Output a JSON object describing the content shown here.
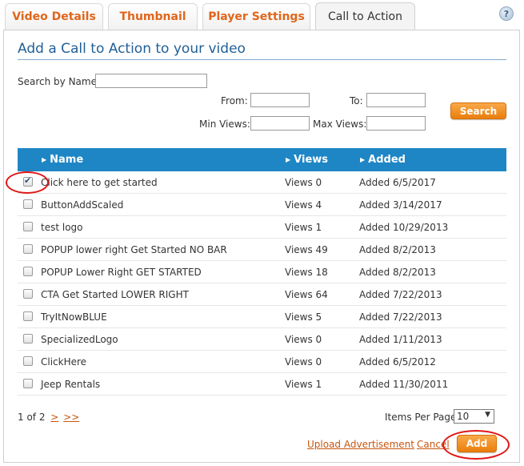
{
  "tabs": [
    {
      "label": "Video Details",
      "active": false
    },
    {
      "label": "Thumbnail",
      "active": false
    },
    {
      "label": "Player Settings",
      "active": false
    },
    {
      "label": "Call to Action",
      "active": true
    }
  ],
  "help_label": "?",
  "panel_title": "Add a Call to Action to your video",
  "search": {
    "name_label": "Search by Name:",
    "from_label": "From:",
    "to_label": "To:",
    "min_views_label": "Min Views:",
    "max_views_label": "Max Views:",
    "name_value": "",
    "from_value": "",
    "to_value": "",
    "min_value": "",
    "max_value": "",
    "button_label": "Search"
  },
  "table": {
    "headers": [
      "Name",
      "Views",
      "Added"
    ],
    "rows": [
      {
        "name": "Click here to get started",
        "views": "Views 0",
        "added": "Added 6/5/2017",
        "checked": true
      },
      {
        "name": "ButtonAddScaled",
        "views": "Views 4",
        "added": "Added 3/14/2017",
        "checked": false
      },
      {
        "name": "test logo",
        "views": "Views 1",
        "added": "Added 10/29/2013",
        "checked": false
      },
      {
        "name": "POPUP lower right Get Started NO BAR",
        "views": "Views 49",
        "added": "Added 8/2/2013",
        "checked": false
      },
      {
        "name": "POPUP Lower Right GET STARTED",
        "views": "Views 18",
        "added": "Added 8/2/2013",
        "checked": false
      },
      {
        "name": "CTA Get Started LOWER RIGHT",
        "views": "Views 64",
        "added": "Added 7/22/2013",
        "checked": false
      },
      {
        "name": "TryItNowBLUE",
        "views": "Views 5",
        "added": "Added 7/22/2013",
        "checked": false
      },
      {
        "name": "SpecializedLogo",
        "views": "Views 0",
        "added": "Added 1/11/2013",
        "checked": false
      },
      {
        "name": "ClickHere",
        "views": "Views 0",
        "added": "Added 6/5/2012",
        "checked": false
      },
      {
        "name": "Jeep Rentals",
        "views": "Views 1",
        "added": "Added 11/30/2011",
        "checked": false
      }
    ]
  },
  "pagination": {
    "page_text": "1 of 2",
    "next": ">",
    "last": ">>",
    "items_per_page_label": "Items Per Page",
    "items_per_page_value": "10"
  },
  "footer": {
    "upload_label": "Upload Advertisement",
    "cancel_label": "Cancel",
    "add_label": "Add"
  },
  "colors": {
    "accent_orange": "#e0661b",
    "header_blue": "#1e86c5",
    "title_blue": "#1f5f96",
    "highlight_red": "#e01515"
  },
  "icons": {
    "help": "question-mark-icon",
    "sort": "triangle-right-icon",
    "checkbox": "checkbox-icon",
    "dropdown": "chevron-down-icon"
  }
}
